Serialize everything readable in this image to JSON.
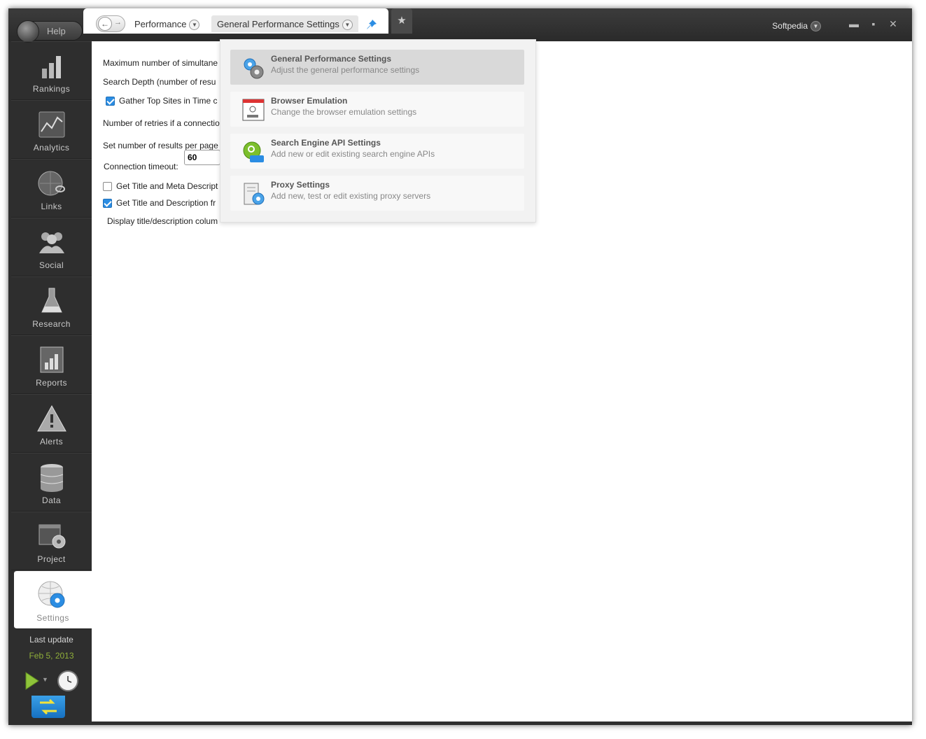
{
  "topbar": {
    "help_label": "Help",
    "user_label": "Softpedia"
  },
  "sidebar": {
    "items": [
      {
        "label": "Rankings",
        "icon": "rankings-bar-icon"
      },
      {
        "label": "Analytics",
        "icon": "analytics-chart-icon"
      },
      {
        "label": "Links",
        "icon": "links-globe-chain-icon"
      },
      {
        "label": "Social",
        "icon": "social-people-icon"
      },
      {
        "label": "Research",
        "icon": "research-flask-icon"
      },
      {
        "label": "Reports",
        "icon": "reports-document-icon"
      },
      {
        "label": "Alerts",
        "icon": "alerts-warning-icon"
      },
      {
        "label": "Data",
        "icon": "data-database-icon"
      },
      {
        "label": "Project",
        "icon": "project-window-gear-icon"
      },
      {
        "label": "Settings",
        "icon": "settings-globe-gear-icon",
        "active": true
      }
    ],
    "last_update_label": "Last update",
    "last_update_date": "Feb 5, 2013"
  },
  "breadcrumb": {
    "section": "Performance",
    "page": "General Performance Settings"
  },
  "form": {
    "max_simultaneous_label": "Maximum number of simultane",
    "search_depth_label": "Search Depth (number of resu",
    "gather_top_sites_label": "Gather Top Sites in Time c",
    "retries_label": "Number of retries if a connectio",
    "results_per_page_label": "Set number of results per page",
    "connection_timeout_label": "Connection timeout:",
    "connection_timeout_value": "60",
    "get_title_meta_label": "Get Title and Meta Descript",
    "get_title_desc_label": "Get Title and Description fr",
    "display_columns_label": "Display title/description colum"
  },
  "dropdown": {
    "items": [
      {
        "title": "General Performance Settings",
        "desc": "Adjust the general performance settings",
        "icon": "gears-icon",
        "selected": true
      },
      {
        "title": "Browser Emulation",
        "desc": "Change the browser emulation settings",
        "icon": "browser-window-icon",
        "selected": false
      },
      {
        "title": "Search Engine API Settings",
        "desc": "Add new or edit existing search engine APIs",
        "icon": "api-search-icon",
        "selected": false
      },
      {
        "title": "Proxy Settings",
        "desc": "Add new, test or edit existing proxy servers",
        "icon": "proxy-server-gear-icon",
        "selected": false
      }
    ]
  },
  "colors": {
    "accent_blue": "#2b8de3",
    "date_green": "#8fae3a",
    "chrome_dark": "#2e2e2e"
  }
}
